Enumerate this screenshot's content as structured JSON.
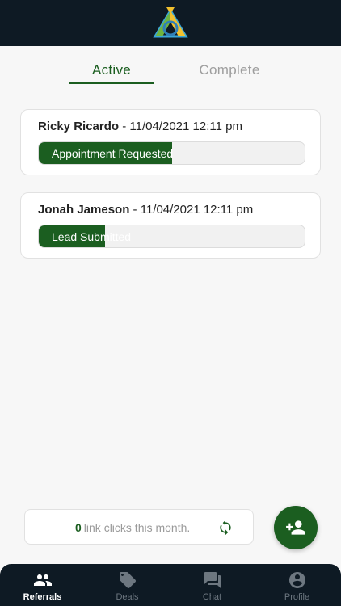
{
  "tabs": [
    {
      "label": "Active"
    },
    {
      "label": "Complete"
    }
  ],
  "referrals": [
    {
      "name": "Ricky Ricardo",
      "date": "- 11/04/2021 12:11 pm",
      "status": "Appointment Requested",
      "progress": 0.5
    },
    {
      "name": "Jonah Jameson",
      "date": "- 11/04/2021 12:11 pm",
      "status": "Lead Submitted",
      "progress": 0.25
    }
  ],
  "clicks": {
    "count": "0",
    "text": "link clicks this month."
  },
  "nav": [
    {
      "label": "Referrals",
      "icon": "people-icon"
    },
    {
      "label": "Deals",
      "icon": "tag-icon"
    },
    {
      "label": "Chat",
      "icon": "chat-icon"
    },
    {
      "label": "Profile",
      "icon": "account-circle-icon"
    }
  ],
  "colors": {
    "brand_green": "#1b5e20",
    "dark_navy": "#0e1a24"
  }
}
